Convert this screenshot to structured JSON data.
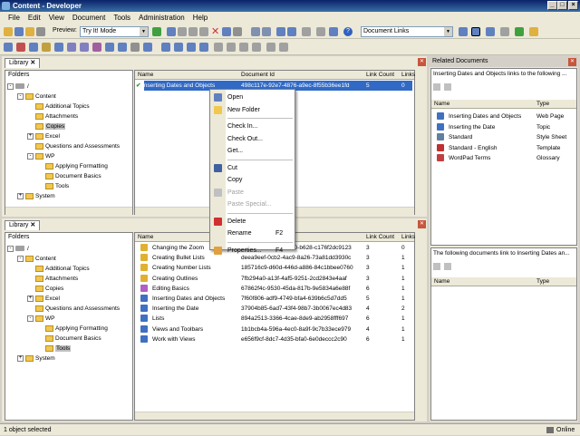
{
  "window": {
    "title": "Content - Developer"
  },
  "menu": [
    "File",
    "Edit",
    "View",
    "Document",
    "Tools",
    "Administration",
    "Help"
  ],
  "toolbar": {
    "preview_label": "Preview:",
    "preview_value": "Try It! Mode",
    "doc_links_value": "Document Links"
  },
  "library_top": {
    "tab": "Library",
    "folders_header": "Folders",
    "tree": [
      {
        "label": "/",
        "level": 0,
        "expander": "-"
      },
      {
        "label": "Content",
        "level": 1,
        "expander": "-"
      },
      {
        "label": "Additional Topics",
        "level": 2,
        "expander": ""
      },
      {
        "label": "Attachments",
        "level": 2,
        "expander": ""
      },
      {
        "label": "Copies",
        "level": 2,
        "expander": "",
        "selected": true
      },
      {
        "label": "Excel",
        "level": 2,
        "expander": "+"
      },
      {
        "label": "Questions and Assessments",
        "level": 2,
        "expander": ""
      },
      {
        "label": "WP",
        "level": 2,
        "expander": "-"
      },
      {
        "label": "Applying Formatting",
        "level": 3,
        "expander": ""
      },
      {
        "label": "Document Basics",
        "level": 3,
        "expander": ""
      },
      {
        "label": "Tools",
        "level": 3,
        "expander": ""
      },
      {
        "label": "System",
        "level": 1,
        "expander": "+"
      }
    ],
    "columns": [
      "Name",
      "Document Id",
      "Link Count",
      "Links"
    ],
    "rows": [
      {
        "name": "Inserting Dates and Objects",
        "id": "498c117e-92e7-4876-a9ec-8f55b36ee1fd",
        "count": "5",
        "links": "0"
      }
    ]
  },
  "context_menu": [
    {
      "label": "Open",
      "shortcut": "",
      "disabled": false,
      "icon": "open-icon",
      "color": "#6080c0"
    },
    {
      "label": "New Folder",
      "shortcut": "",
      "disabled": false,
      "icon": "new-folder-icon",
      "color": "#f0c850"
    },
    {
      "sep": true
    },
    {
      "label": "Check In...",
      "shortcut": "",
      "disabled": false,
      "icon": "",
      "color": ""
    },
    {
      "label": "Check Out...",
      "shortcut": "",
      "disabled": false,
      "icon": "",
      "color": ""
    },
    {
      "label": "Get...",
      "shortcut": "",
      "disabled": false,
      "icon": "",
      "color": ""
    },
    {
      "sep": true
    },
    {
      "label": "Cut",
      "shortcut": "",
      "disabled": false,
      "icon": "scissors-icon",
      "color": "#4060a0"
    },
    {
      "label": "Copy",
      "shortcut": "",
      "disabled": false,
      "icon": "",
      "color": ""
    },
    {
      "label": "Paste",
      "shortcut": "",
      "disabled": true,
      "icon": "paste-icon",
      "color": "#c0c0c0"
    },
    {
      "label": "Paste Special...",
      "shortcut": "",
      "disabled": true,
      "icon": "",
      "color": ""
    },
    {
      "sep": true
    },
    {
      "label": "Delete",
      "shortcut": "",
      "disabled": false,
      "icon": "delete-x-icon",
      "color": "#d03030"
    },
    {
      "label": "Rename",
      "shortcut": "F2",
      "disabled": false,
      "icon": "",
      "color": ""
    },
    {
      "sep": true
    },
    {
      "label": "Properties...",
      "shortcut": "F4",
      "disabled": false,
      "icon": "properties-icon",
      "color": "#e0a040"
    }
  ],
  "library_bottom": {
    "tab": "Library",
    "folders_header": "Folders",
    "tree": [
      {
        "label": "/",
        "level": 0,
        "expander": "-"
      },
      {
        "label": "Content",
        "level": 1,
        "expander": "-"
      },
      {
        "label": "Additional Topics",
        "level": 2,
        "expander": ""
      },
      {
        "label": "Attachments",
        "level": 2,
        "expander": ""
      },
      {
        "label": "Copies",
        "level": 2,
        "expander": ""
      },
      {
        "label": "Excel",
        "level": 2,
        "expander": "+"
      },
      {
        "label": "Questions and Assessments",
        "level": 2,
        "expander": ""
      },
      {
        "label": "WP",
        "level": 2,
        "expander": "-"
      },
      {
        "label": "Applying Formatting",
        "level": 3,
        "expander": ""
      },
      {
        "label": "Document Basics",
        "level": 3,
        "expander": ""
      },
      {
        "label": "Tools",
        "level": 3,
        "expander": "",
        "selected": true
      },
      {
        "label": "System",
        "level": 1,
        "expander": "+"
      }
    ],
    "columns": [
      "Name",
      "Document Id",
      "Link Count",
      "Links"
    ],
    "rows": [
      {
        "name": "Changing the Zoom",
        "id": "5bdb6527-4023-4d30-b628-c176f2dc9123",
        "count": "3",
        "links": "0",
        "color": "#e0b030"
      },
      {
        "name": "Creating Bullet Lists",
        "id": "deea9eef-0cb2-4ac9-8a26-73a81dd3930c",
        "count": "3",
        "links": "1",
        "color": "#e0b030"
      },
      {
        "name": "Creating Number Lists",
        "id": "185716c9-d60d-446d-a886-84c1bbee0760",
        "count": "3",
        "links": "1",
        "color": "#e0b030"
      },
      {
        "name": "Creating Outlines",
        "id": "7fb294a0-a13f-4af5-9251-2cd2843e4aaf",
        "count": "3",
        "links": "1",
        "color": "#e0b030"
      },
      {
        "name": "Editing Basics",
        "id": "67862f4c-9530-45da-817b-9e5834a6e88f",
        "count": "6",
        "links": "1",
        "color": "#b060c0"
      },
      {
        "name": "Inserting Dates and Objects",
        "id": "7f60f806-adf9-4749-bfa4-639b6c5d7dd5",
        "count": "5",
        "links": "1",
        "color": "#4070c0"
      },
      {
        "name": "Inserting the Date",
        "id": "37904b85-6ad7-43f4-98b7-3b0067ec4d83",
        "count": "4",
        "links": "2",
        "color": "#4070c0"
      },
      {
        "name": "Lists",
        "id": "894a2513-3366-4cae-8de9-ab2958fff697",
        "count": "6",
        "links": "1",
        "color": "#4070c0"
      },
      {
        "name": "Views and Toolbars",
        "id": "1b1bcb4a-596a-4ec0-8a9f-9c7b33ece979",
        "count": "4",
        "links": "1",
        "color": "#4070c0"
      },
      {
        "name": "Work with Views",
        "id": "e656f9cf-8dc7-4d35-bfa0-6e0deccc2c90",
        "count": "6",
        "links": "1",
        "color": "#4070c0"
      }
    ]
  },
  "related": {
    "title": "Related Documents",
    "subtitle": "Inserting Dates and Objects links to the following ...",
    "columns": [
      "Name",
      "Type"
    ],
    "rows": [
      {
        "name": "Inserting Dates and Objects",
        "type": "Web Page",
        "color": "#4070c0"
      },
      {
        "name": "Inserting the Date",
        "type": "Topic",
        "color": "#4070c0"
      },
      {
        "name": "Standard",
        "type": "Style Sheet",
        "color": "#6080a0"
      },
      {
        "name": "Standard - English",
        "type": "Template",
        "color": "#c03030"
      },
      {
        "name": "WordPad Terms",
        "type": "Glossary",
        "color": "#c04040"
      }
    ],
    "subtitle2": "The following documents link to Inserting Dates an...",
    "columns2": [
      "Name",
      "Type"
    ]
  },
  "status": {
    "left": "1 object selected",
    "right": "Online"
  }
}
